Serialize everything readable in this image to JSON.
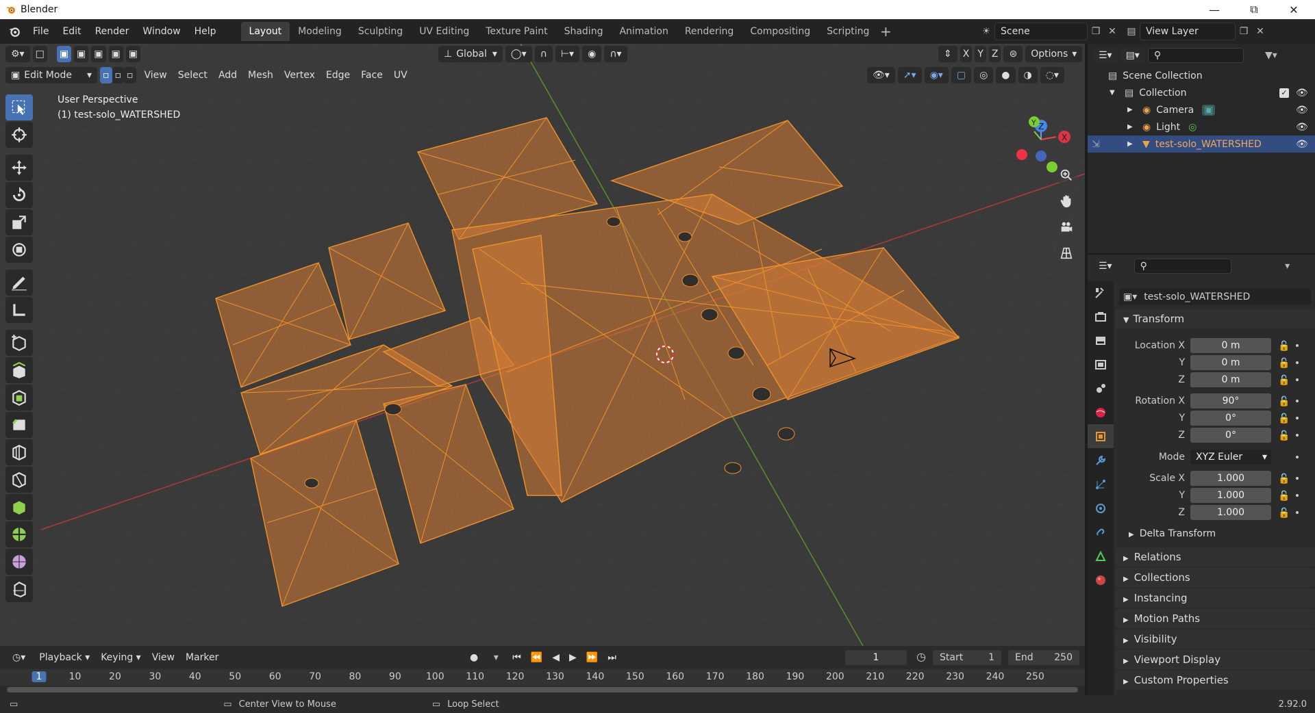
{
  "window": {
    "title": "Blender"
  },
  "menu": [
    "File",
    "Edit",
    "Render",
    "Window",
    "Help"
  ],
  "workspaces": [
    "Layout",
    "Modeling",
    "Sculpting",
    "UV Editing",
    "Texture Paint",
    "Shading",
    "Animation",
    "Rendering",
    "Compositing",
    "Scripting"
  ],
  "active_workspace": "Layout",
  "scene": {
    "scene_name": "Scene",
    "view_layer": "View Layer"
  },
  "viewport": {
    "mode": "Edit Mode",
    "menus": [
      "View",
      "Select",
      "Add",
      "Mesh",
      "Vertex",
      "Edge",
      "Face",
      "UV"
    ],
    "transform_orientation": "Global",
    "options_label": "Options",
    "axes": [
      "X",
      "Y",
      "Z"
    ],
    "overlay_text_1": "User Perspective",
    "overlay_text_2": "(1) test-solo_WATERSHED",
    "gizmo": {
      "x_label": "X",
      "y_label": "Y",
      "z_label": "Z"
    }
  },
  "outliner": {
    "root": "Scene Collection",
    "items": [
      {
        "name": "Collection"
      },
      {
        "name": "Camera"
      },
      {
        "name": "Light"
      },
      {
        "name": "test-solo_WATERSHED"
      }
    ]
  },
  "properties": {
    "object_name": "test-solo_WATERSHED",
    "transform_label": "Transform",
    "location": {
      "label": "Location X",
      "x": "0 m",
      "y": "0 m",
      "z": "0 m"
    },
    "rotation": {
      "label": "Rotation X",
      "x": "90°",
      "y": "0°",
      "z": "0°"
    },
    "mode_label": "Mode",
    "mode_value": "XYZ Euler",
    "scale": {
      "label": "Scale X",
      "x": "1.000",
      "y": "1.000",
      "z": "1.000"
    },
    "y_label": "Y",
    "z_label": "Z",
    "delta_transform": "Delta Transform",
    "sections": [
      "Relations",
      "Collections",
      "Instancing",
      "Motion Paths",
      "Visibility",
      "Viewport Display",
      "Custom Properties"
    ]
  },
  "timeline": {
    "menus": [
      "Playback",
      "Keying",
      "View",
      "Marker"
    ],
    "current_frame": "1",
    "start_label": "Start",
    "start": "1",
    "end_label": "End",
    "end": "250",
    "ticks": [
      "1",
      "10",
      "20",
      "30",
      "40",
      "50",
      "60",
      "70",
      "80",
      "90",
      "100",
      "110",
      "120",
      "130",
      "140",
      "150",
      "160",
      "170",
      "180",
      "190",
      "200",
      "210",
      "220",
      "230",
      "240",
      "250"
    ]
  },
  "status": {
    "hint1": "Center View to Mouse",
    "hint2": "Loop Select",
    "version": "2.92.0"
  }
}
